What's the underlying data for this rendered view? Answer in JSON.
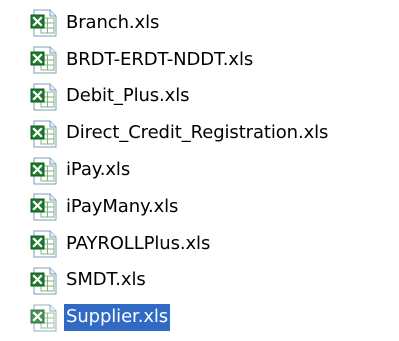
{
  "file_list": {
    "items": [
      {
        "label": "Branch.xls",
        "icon": "excel-file-icon",
        "selected": false
      },
      {
        "label": "BRDT-ERDT-NDDT.xls",
        "icon": "excel-file-icon",
        "selected": false
      },
      {
        "label": "Debit_Plus.xls",
        "icon": "excel-file-icon",
        "selected": false
      },
      {
        "label": "Direct_Credit_Registration.xls",
        "icon": "excel-file-icon",
        "selected": false
      },
      {
        "label": "iPay.xls",
        "icon": "excel-file-icon",
        "selected": false
      },
      {
        "label": "iPayMany.xls",
        "icon": "excel-file-icon",
        "selected": false
      },
      {
        "label": "PAYROLLPlus.xls",
        "icon": "excel-file-icon",
        "selected": false
      },
      {
        "label": "SMDT.xls",
        "icon": "excel-file-icon",
        "selected": false
      },
      {
        "label": "Supplier.xls",
        "icon": "excel-file-icon",
        "selected": true
      }
    ],
    "selection_color": "#316ac5"
  }
}
